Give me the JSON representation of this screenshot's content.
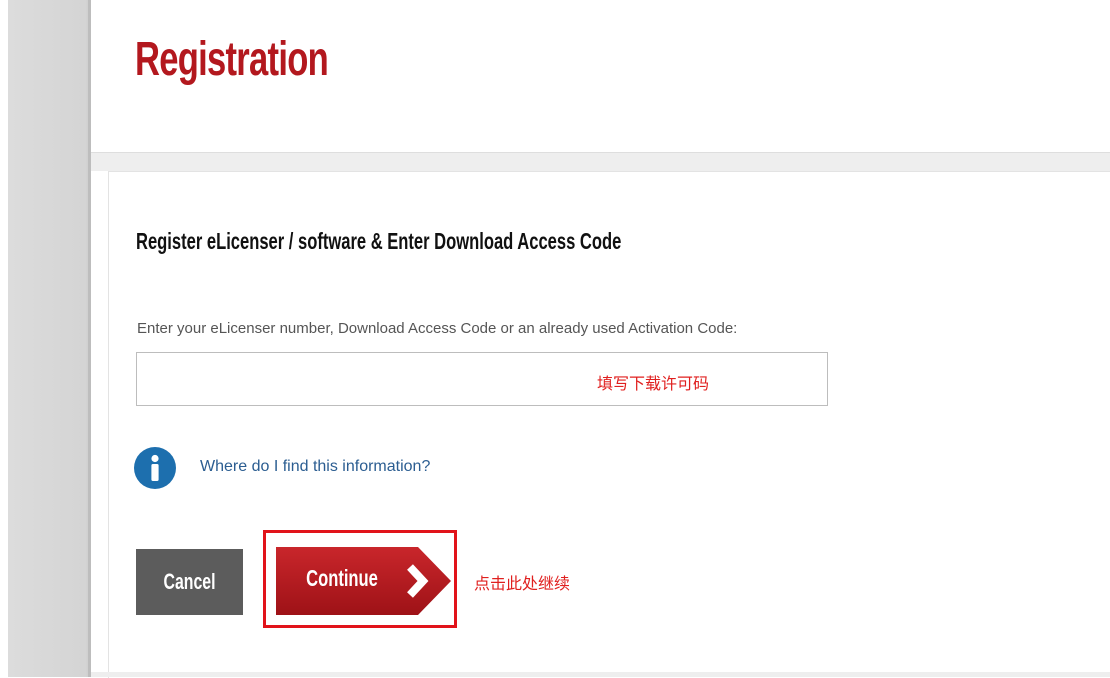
{
  "header": {
    "title": "Registration"
  },
  "form": {
    "heading": "Register eLicenser / software & Enter Download Access Code",
    "field_label": "Enter your eLicenser number, Download Access Code or an already used Activation Code:",
    "input_value": "",
    "help_link": "Where do I find this information?"
  },
  "buttons": {
    "cancel_label": "Cancel",
    "continue_label": "Continue"
  },
  "annotations": {
    "input_note": "填写下载许可码",
    "continue_note": "点击此处继续"
  },
  "colors": {
    "brand_red": "#b3181e",
    "annotation_red": "#e1131a",
    "info_blue": "#1d6fae",
    "link_blue": "#2b5d91",
    "cancel_gray": "#5c5c5c"
  },
  "icons": {
    "info": "info-icon",
    "continue_arrow": "chevron-right-icon"
  }
}
